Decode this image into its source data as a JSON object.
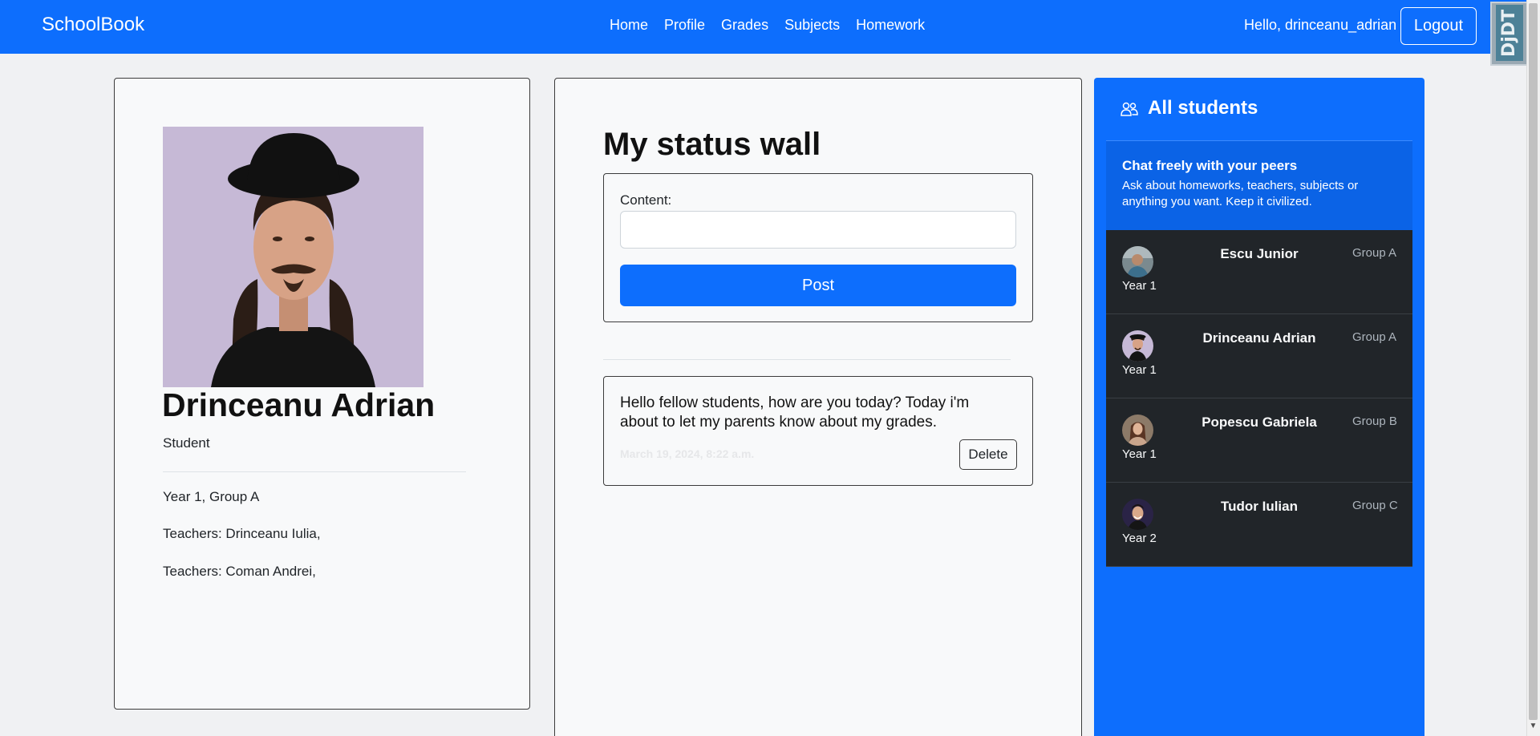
{
  "navbar": {
    "brand": "SchoolBook",
    "links": [
      "Home",
      "Profile",
      "Grades",
      "Subjects",
      "Homework"
    ],
    "greeting": "Hello, drinceanu_adrian",
    "logout_label": "Logout"
  },
  "debug_toolbar": {
    "label": "DjDT"
  },
  "profile": {
    "name": "Drinceanu Adrian",
    "role": "Student",
    "year_group": "Year 1, Group A",
    "teachers": [
      "Teachers: Drinceanu Iulia,",
      "Teachers: Coman Andrei,"
    ]
  },
  "wall": {
    "title": "My status wall",
    "content_label": "Content:",
    "content_value": "",
    "post_label": "Post",
    "posts": [
      {
        "text": "Hello fellow students, how are you today? Today i'm about to let my parents know about my grades.",
        "date": "March 19, 2024, 8:22 a.m.",
        "delete_label": "Delete"
      }
    ]
  },
  "students": {
    "title": "All students",
    "chat_title": "Chat freely with your peers",
    "chat_desc": "Ask about homeworks, teachers, subjects or anything you want. Keep it civilized.",
    "list": [
      {
        "name": "Escu Junior",
        "group": "Group A",
        "year": "Year 1"
      },
      {
        "name": "Drinceanu Adrian",
        "group": "Group A",
        "year": "Year 1"
      },
      {
        "name": "Popescu Gabriela",
        "group": "Group B",
        "year": "Year 1"
      },
      {
        "name": "Tudor Iulian",
        "group": "Group C",
        "year": "Year 2"
      }
    ]
  },
  "colors": {
    "primary": "#0d6efd",
    "dark_row": "#212529",
    "background": "#f0f1f3"
  }
}
